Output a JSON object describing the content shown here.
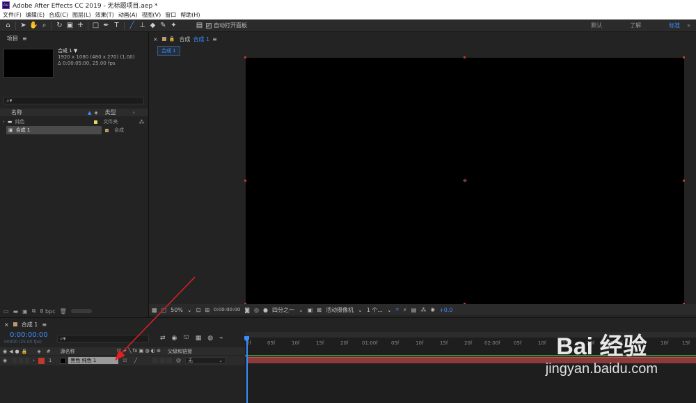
{
  "window": {
    "title": "Adobe After Effects CC 2019 - 无标题项目.aep *",
    "app_icon": "Ae"
  },
  "menu": [
    "文件(F)",
    "编辑(E)",
    "合成(C)",
    "图层(L)",
    "效果(T)",
    "动画(A)",
    "视图(V)",
    "窗口",
    "帮助(H)"
  ],
  "toolbar": {
    "auto_open": "自动打开面板",
    "workspaces": [
      "默认",
      "了解",
      "标准"
    ],
    "active_workspace": "标准",
    "overflow": "»"
  },
  "project": {
    "title": "项目",
    "menu_icon": "≡",
    "comp_name": "合成 1 ▼",
    "comp_res": "1920 x 1080 (480 x 270) (1.00)",
    "comp_dur": "Δ 0:00:05:00, 25.00 fps",
    "col_name": "名称",
    "col_type": "类型",
    "items": [
      {
        "name": "纯色",
        "type": "文件夹",
        "color": "#e8d66a"
      },
      {
        "name": "合成 1",
        "type": "合成",
        "color": "#b89a70"
      }
    ],
    "bpc": "8 bpc"
  },
  "viewer": {
    "panel_label": "合成",
    "tab": "合成 1",
    "subtab": "合成 1",
    "zoom": "50%",
    "time": "0:00:00:00",
    "resolution": "四分之一",
    "camera": "活动摄像机",
    "views": "1 个...",
    "exposure": "+0.0"
  },
  "timeline": {
    "tab": "合成 1",
    "menu_icon": "≡",
    "timecode": "0:00:00:00",
    "fps_line": "00000 (25.00 fps)",
    "col_num": "#",
    "col_source": "源名称",
    "col_parent": "父级和链接",
    "layer": {
      "num": "1",
      "name": "黑色 纯色 1",
      "parent": "无"
    },
    "ruler": [
      "0f",
      "05f",
      "10f",
      "15f",
      "20f",
      "01:00f",
      "05f",
      "10f",
      "15f",
      "20f",
      "02:00f",
      "05f",
      "10f",
      "15f",
      "20f",
      "03:00f",
      "05f",
      "10f",
      "15f"
    ]
  },
  "watermark": {
    "brand": "Bai 经验",
    "url": "jingyan.baidu.com"
  },
  "colors": {
    "accent": "#3a8eff",
    "solid_label": "#c0392b",
    "layer_bar": "#8f3a3a"
  }
}
